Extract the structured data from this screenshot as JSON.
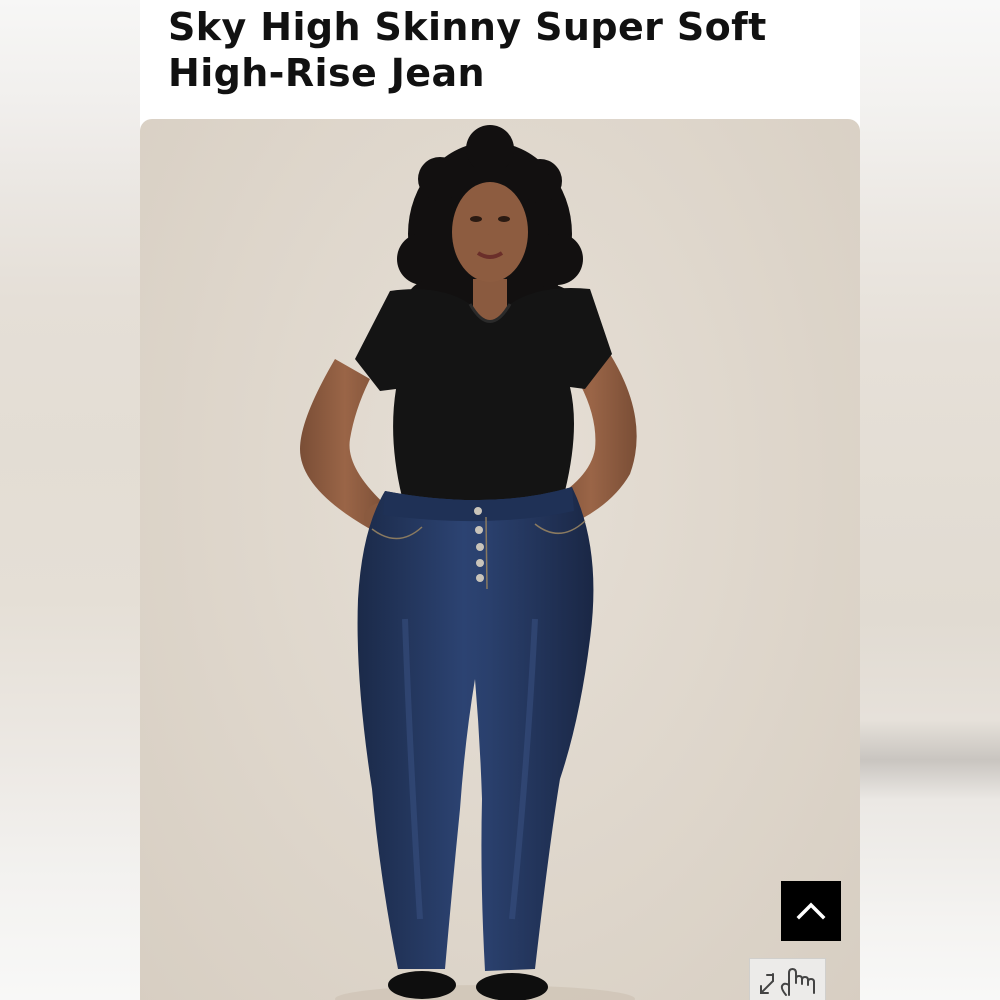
{
  "product": {
    "title_line1": "Sky High Skinny Super Soft",
    "title_line2": "High-Rise Jean"
  },
  "image": {
    "subject": "model-wearing-dark-wash-high-rise-skinny-jeans",
    "background_color": "#ded6cb"
  },
  "controls": {
    "back_to_top_icon": "chevron-up-icon",
    "zoom_icon": "expand-pointer-icon"
  },
  "colors": {
    "title": "#111111",
    "button_bg": "#000000",
    "denim": "#22355a",
    "top": "#141414"
  }
}
